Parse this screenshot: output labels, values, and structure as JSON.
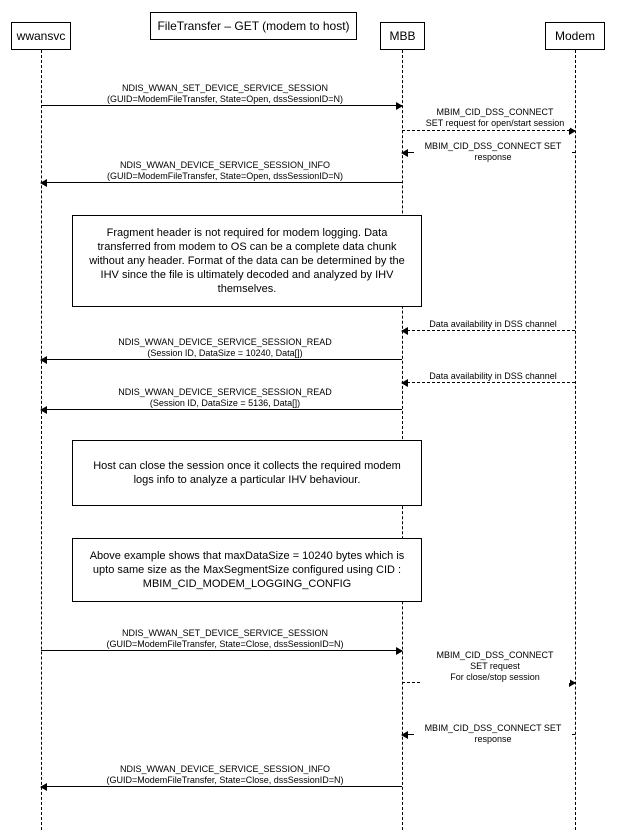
{
  "actors": {
    "wwansvc": "wwansvc",
    "mbb": "MBB",
    "modem": "Modem"
  },
  "title_box": "FileTransfer – GET (modem to host)",
  "messages": {
    "m1_a": "NDIS_WWAN_SET_DEVICE_SERVICE_SESSION",
    "m1_b": "(GUID=ModemFileTransfer, State=Open, dssSessionID=N)",
    "m2_a": "MBIM_CID_DSS_CONNECT",
    "m2_b": "SET request for open/start session",
    "m3": "MBIM_CID_DSS_CONNECT SET response",
    "m4_a": "NDIS_WWAN_DEVICE_SERVICE_SESSION_INFO",
    "m4_b": "(GUID=ModemFileTransfer, State=Open, dssSessionID=N)",
    "m5": "Data availability in DSS channel",
    "m6_a": "NDIS_WWAN_DEVICE_SERVICE_SESSION_READ",
    "m6_b": "(Session ID, DataSize = 10240, Data[])",
    "m7": "Data availability in DSS channel",
    "m8_a": "NDIS_WWAN_DEVICE_SERVICE_SESSION_READ",
    "m8_b": "(Session ID, DataSize = 5136, Data[])",
    "m9_a": "NDIS_WWAN_SET_DEVICE_SERVICE_SESSION",
    "m9_b": "(GUID=ModemFileTransfer, State=Close, dssSessionID=N)",
    "m10_a": "MBIM_CID_DSS_CONNECT",
    "m10_b": "SET request",
    "m10_c": "For close/stop session",
    "m11": "MBIM_CID_DSS_CONNECT SET response",
    "m12_a": "NDIS_WWAN_DEVICE_SERVICE_SESSION_INFO",
    "m12_b": "(GUID=ModemFileTransfer, State=Close, dssSessionID=N)"
  },
  "notes": {
    "n1": "Fragment header is not required for modem logging. Data transferred from modem to OS can be a complete data chunk without any header. Format of the data can be determined by the IHV since the file is ultimately decoded and analyzed by IHV themselves.",
    "n2": "Host can close the session once it collects the required modem logs info to analyze a particular IHV behaviour.",
    "n3": "Above example shows that maxDataSize = 10240 bytes which is upto same size as the MaxSegmentSize configured using CID : MBIM_CID_MODEM_LOGGING_CONFIG"
  }
}
